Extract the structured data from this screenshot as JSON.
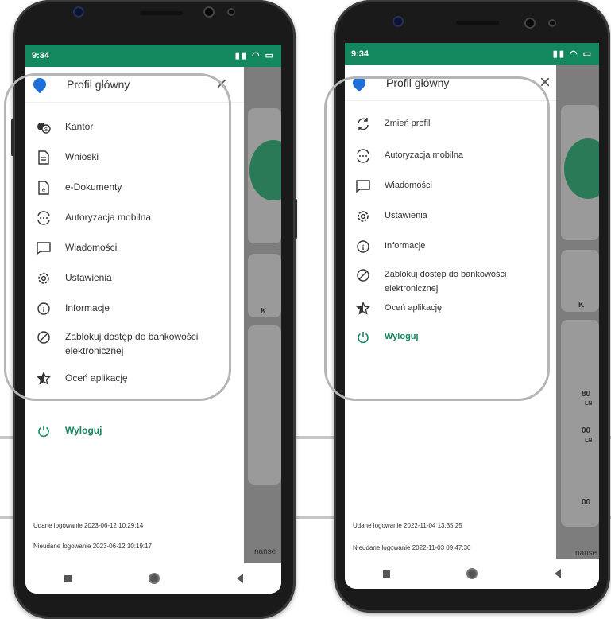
{
  "left_phone": {
    "status_time": "9:34",
    "profile_title": "Profil główny",
    "menu": [
      {
        "label": "Kantor",
        "icon": "currency-exchange-icon"
      },
      {
        "label": "Wnioski",
        "icon": "document-icon"
      },
      {
        "label": "e-Dokumenty",
        "icon": "e-document-icon"
      },
      {
        "label": "Autoryzacja mobilna",
        "icon": "mobile-authorization-icon"
      },
      {
        "label": "Wiadomości",
        "icon": "message-icon"
      },
      {
        "label": "Ustawienia",
        "icon": "settings-icon"
      },
      {
        "label": "Informacje",
        "icon": "info-icon"
      },
      {
        "label": "Zablokuj dostęp do bankowości elektronicznej",
        "icon": "block-icon"
      },
      {
        "label": "Oceń aplikację",
        "icon": "star-icon"
      }
    ],
    "logout": "Wyloguj",
    "login_success": "Udane logowanie 2023-06-12 10:29:14",
    "login_failed": "Nieudane logowanie 2023-06-12 10:19:17",
    "bg_texts": [
      "K",
      "nanse"
    ]
  },
  "right_phone": {
    "status_time": "9:34",
    "profile_title": "Profil główny",
    "menu": [
      {
        "label": "Zmień profil",
        "icon": "switch-profile-icon"
      },
      {
        "label": "Autoryzacja mobilna",
        "icon": "mobile-authorization-icon"
      },
      {
        "label": "Wiadomości",
        "icon": "message-icon"
      },
      {
        "label": "Ustawienia",
        "icon": "settings-icon"
      },
      {
        "label": "Informacje",
        "icon": "info-icon"
      },
      {
        "label": "Zablokuj dostęp do bankowości elektronicznej",
        "icon": "block-icon"
      },
      {
        "label": "Oceń aplikację",
        "icon": "star-icon"
      }
    ],
    "logout": "Wyloguj",
    "login_success": "Udane logowanie 2022-11-04 13:35:25",
    "login_failed": "Nieudane logowanie 2022-11-03 09:47:30",
    "bg_texts": [
      "K",
      "80",
      "LN",
      "00",
      "LN",
      "00",
      "nanse"
    ]
  },
  "colors": {
    "accent": "#13875d",
    "pin": "#1e6fd9",
    "overlay": "#7d7d7d"
  }
}
